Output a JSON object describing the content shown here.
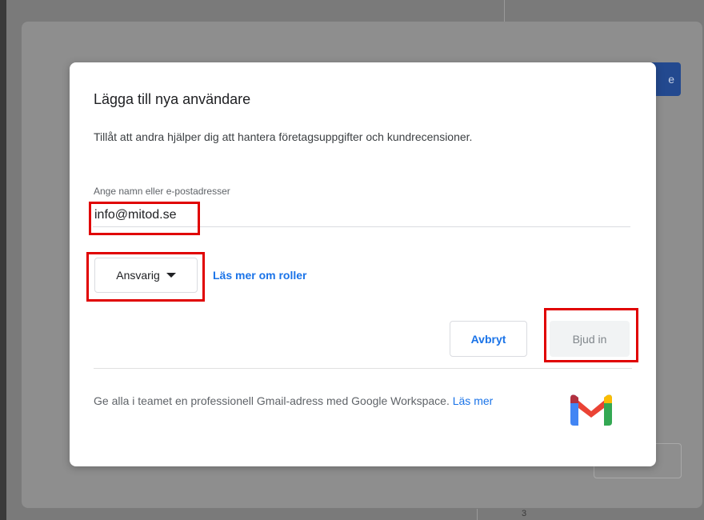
{
  "background": {
    "partial_button_text": "e",
    "page_number": "3"
  },
  "dialog": {
    "title": "Lägga till nya användare",
    "description": "Tillåt att andra hjälper dig att hantera företagsuppgifter och kundrecensioner.",
    "field": {
      "label": "Ange namn eller e-postadresser",
      "value": "info@mitod.se"
    },
    "role": {
      "selected": "Ansvarig",
      "learn_more_link": "Läs mer om roller"
    },
    "buttons": {
      "cancel": "Avbryt",
      "invite": "Bjud in"
    },
    "promo": {
      "text": "Ge alla i teamet en professionell Gmail-adress med Google Workspace. ",
      "link": "Läs mer"
    }
  },
  "icons": {
    "role_dropdown": "caret-down-icon",
    "promo_logo": "gmail-logo-icon"
  },
  "colors": {
    "accent": "#1a73e8",
    "highlight": "#e00000",
    "disabled_button_bg": "#f1f3f4",
    "gmail_red": "#ea4335",
    "gmail_blue": "#4285f4",
    "gmail_green": "#34a853",
    "gmail_yellow": "#fbbc04"
  }
}
